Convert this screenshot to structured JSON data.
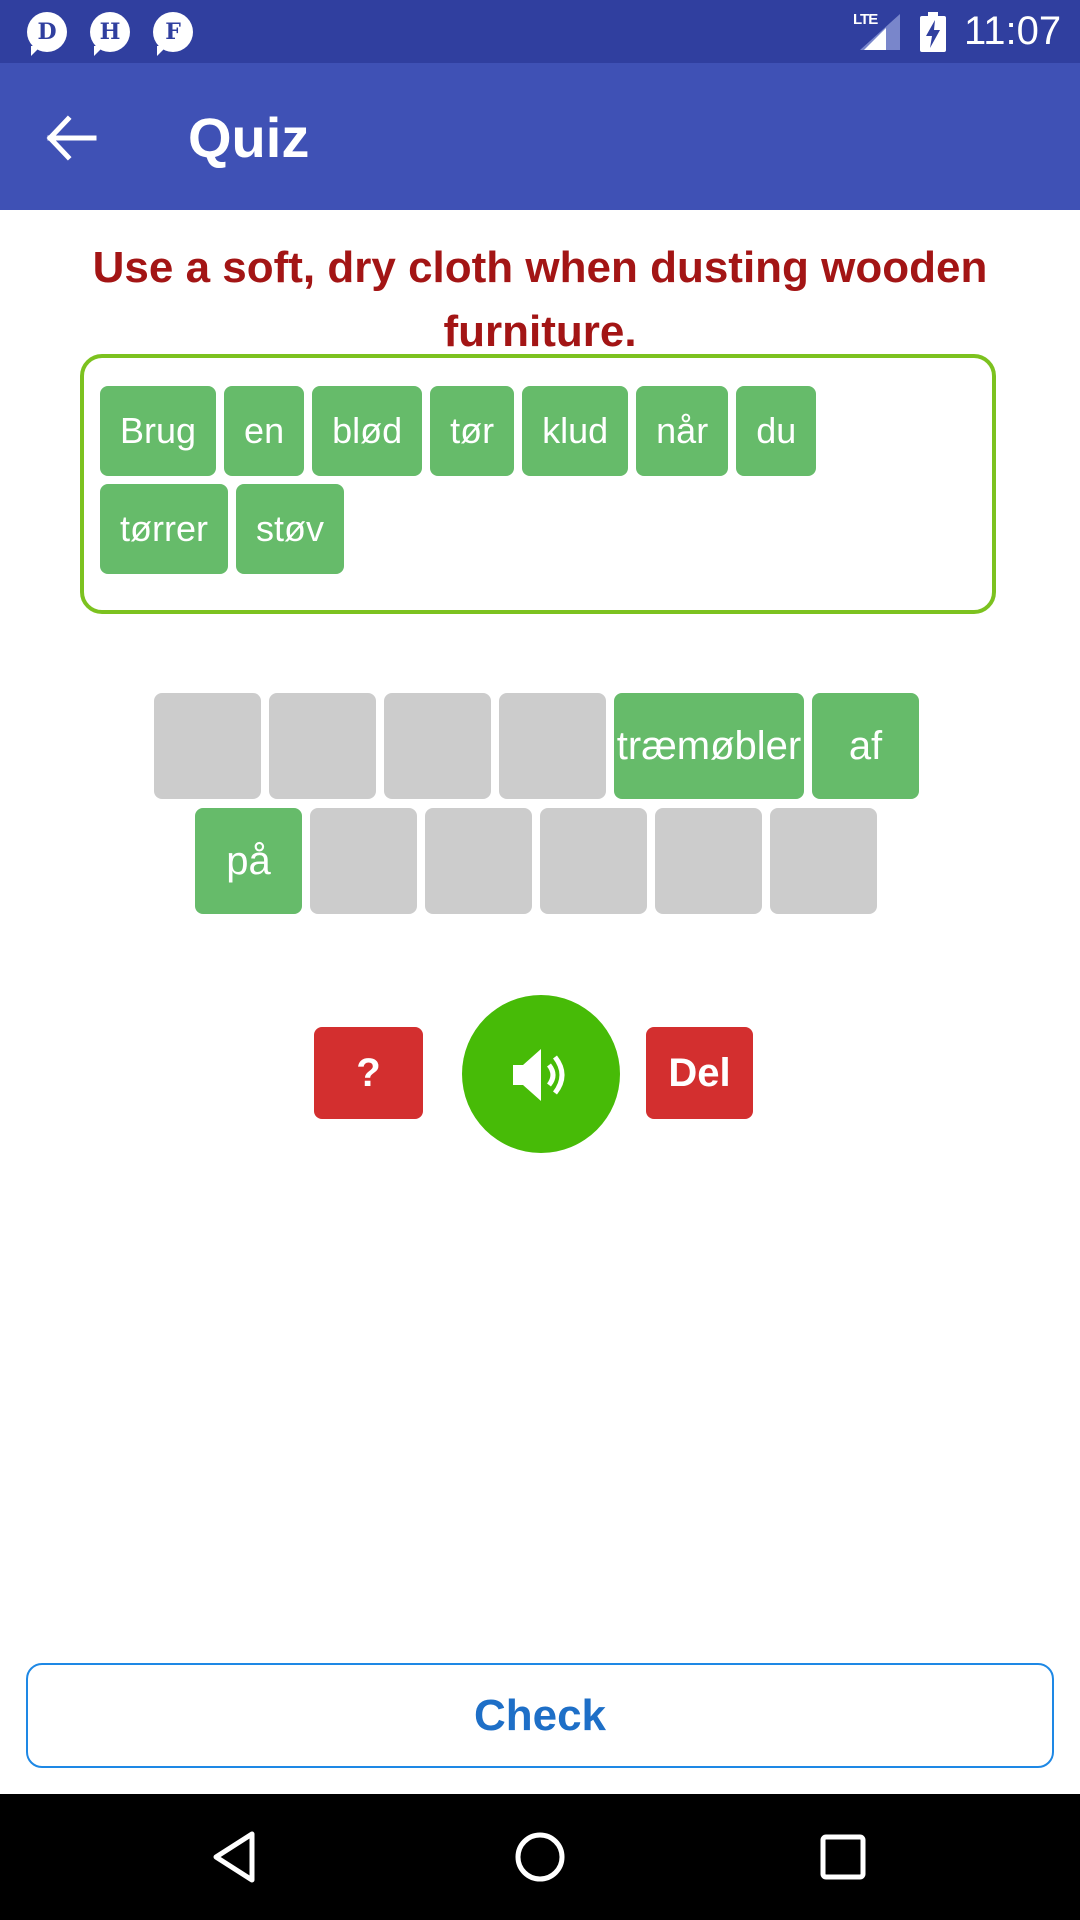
{
  "status_bar": {
    "notifications": [
      {
        "letter": "D",
        "icon": "d-notification-icon"
      },
      {
        "letter": "H",
        "icon": "h-notification-icon"
      },
      {
        "letter": "F",
        "icon": "f-notification-icon"
      }
    ],
    "network_label": "LTE",
    "time": "11:07",
    "color": "#303f9f"
  },
  "app_bar": {
    "title": "Quiz",
    "back_icon": "arrow-left-icon",
    "color": "#3f51b5"
  },
  "quiz": {
    "sentence": "Use a soft, dry cloth when dusting wooden furniture.",
    "word_bank_rows": [
      [
        "Brug",
        "en",
        "blød",
        "tør",
        "klud",
        "når",
        "du"
      ],
      [
        "tørrer",
        "støv"
      ]
    ],
    "answer_rows": [
      [
        "",
        "",
        "",
        "",
        "træmøbler",
        "af"
      ],
      [
        "på",
        "",
        "",
        "",
        "",
        ""
      ]
    ],
    "hint_label": "?",
    "speaker_icon": "speaker-icon",
    "delete_label": "Del",
    "check_label": "Check"
  },
  "colors": {
    "chip": "#66bb6a",
    "empty_slot": "#cccccc",
    "sentence": "#a31515",
    "word_bank_border": "#7cc21f",
    "danger": "#d32f2f",
    "speaker": "#47bb07",
    "check_text": "#1e6fc7"
  },
  "nav_bar": {
    "back_icon": "nav-back-triangle-icon",
    "home_icon": "nav-home-circle-icon",
    "recents_icon": "nav-recents-square-icon"
  }
}
